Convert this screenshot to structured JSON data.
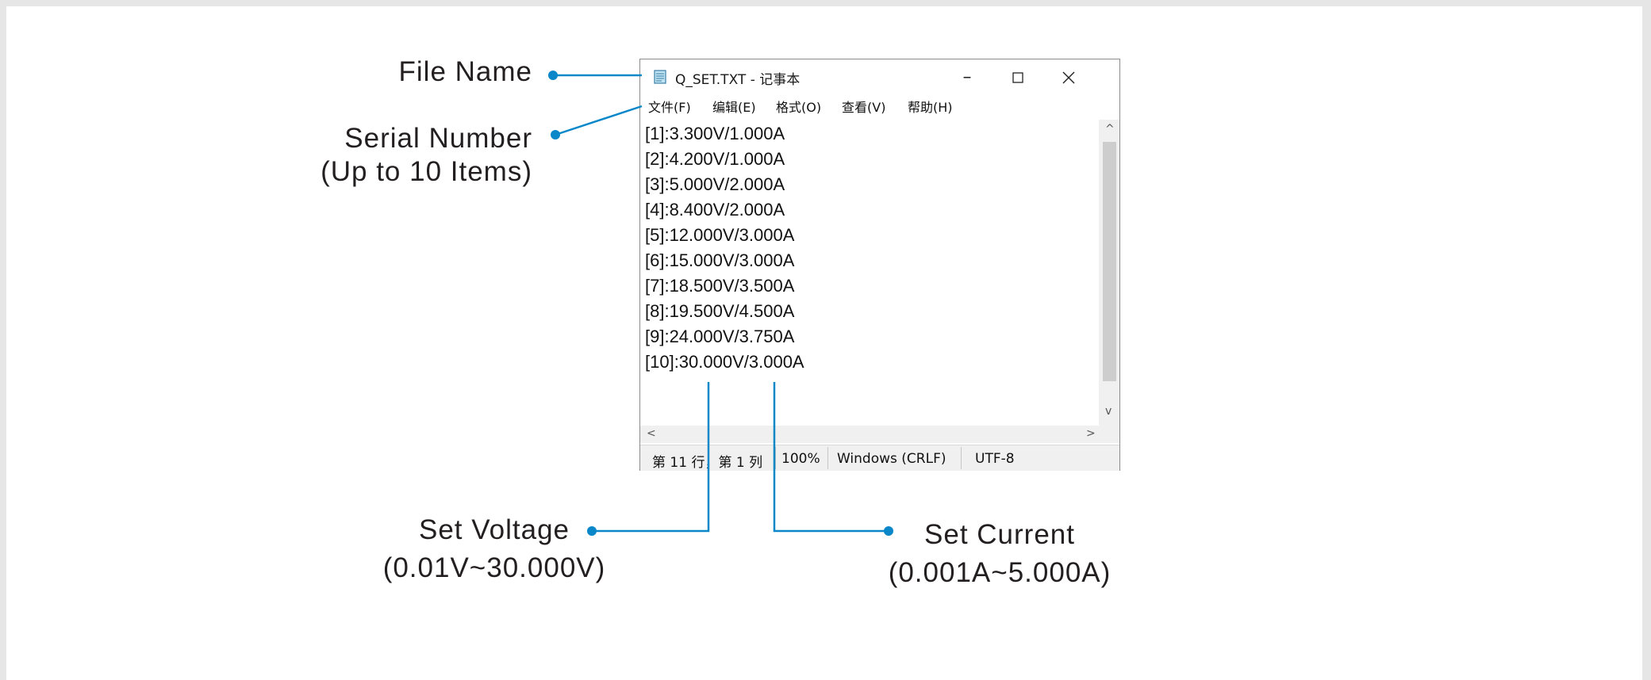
{
  "callouts": {
    "file_name": "File Name",
    "serial_line1": "Serial Number",
    "serial_line2": "(Up to 10 Items)",
    "voltage_line1": "Set Voltage",
    "voltage_line2": "(0.01V~30.000V)",
    "current_line1": "Set Current",
    "current_line2": "(0.001A~5.000A)"
  },
  "colors": {
    "accent": "#0a87c8",
    "text": "#231f20"
  },
  "window": {
    "icon": "notepad-icon",
    "title": "Q_SET.TXT - 记事本",
    "controls": {
      "minimize": "–",
      "maximize": "□",
      "close": "✕"
    },
    "menu": [
      "文件(F)",
      "编辑(E)",
      "格式(O)",
      "查看(V)",
      "帮助(H)"
    ],
    "lines": [
      "[1]:3.300V/1.000A",
      "[2]:4.200V/1.000A",
      "[3]:5.000V/2.000A",
      "[4]:8.400V/2.000A",
      "[5]:12.000V/3.000A",
      "[6]:15.000V/3.000A",
      "[7]:18.500V/3.500A",
      "[8]:19.500V/4.500A",
      "[9]:24.000V/3.750A",
      "[10]:30.000V/3.000A"
    ],
    "scroll_arrows": {
      "up": "^",
      "down": "v",
      "left": "<",
      "right": ">"
    },
    "status": {
      "position": "第 11 行，第 1 列",
      "zoom": "100%",
      "line_ending": "Windows (CRLF)",
      "encoding": "UTF-8"
    }
  }
}
